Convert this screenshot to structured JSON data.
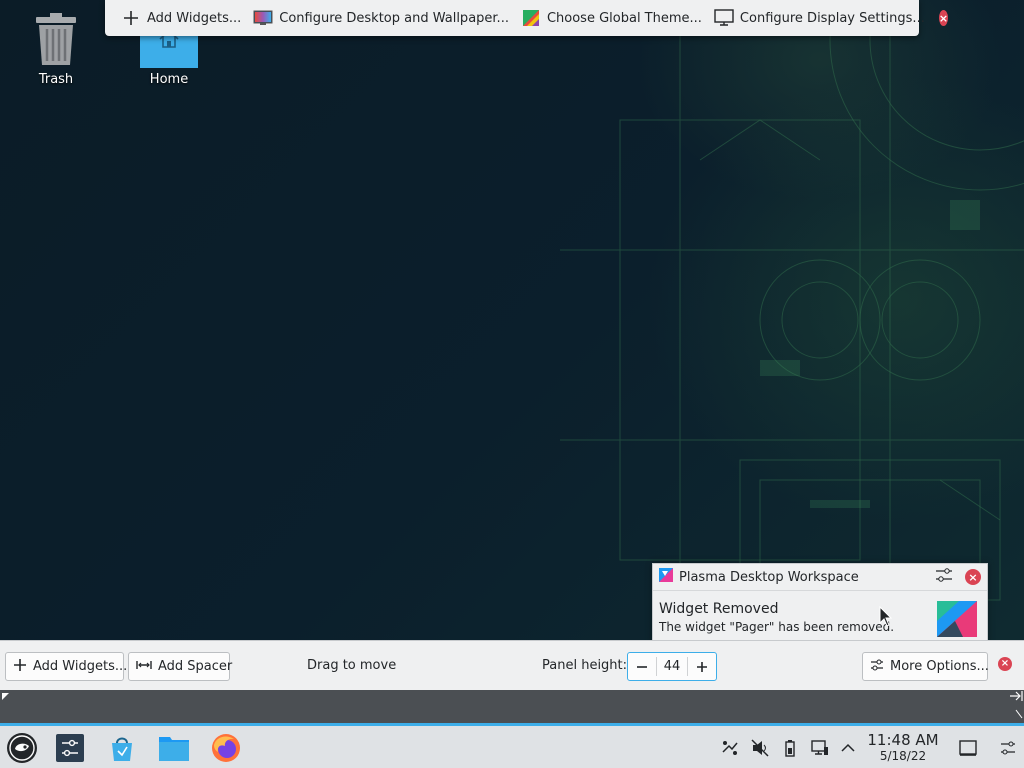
{
  "desktop": {
    "icons": [
      {
        "label": "Trash"
      },
      {
        "label": "Home"
      }
    ]
  },
  "toolbox": {
    "add_widgets": "Add Widgets...",
    "configure_desktop": "Configure Desktop and Wallpaper...",
    "global_theme": "Choose Global Theme...",
    "display_settings": "Configure Display Settings..."
  },
  "notification": {
    "app_name": "Plasma Desktop Workspace",
    "title": "Widget Removed",
    "text": "The widget \"Pager\" has been removed."
  },
  "panel_config": {
    "add_widgets": "Add Widgets...",
    "add_spacer": "Add Spacer",
    "drag_label": "Drag to move",
    "height_label": "Panel height:",
    "height_value": "44",
    "more_options": "More Options..."
  },
  "taskbar": {
    "launchers": [
      "application-launcher",
      "system-settings",
      "discover",
      "dolphin-file-manager",
      "firefox"
    ],
    "tray_icons": [
      "kde-connect-icon",
      "volume-muted-icon",
      "battery-icon",
      "network-icon",
      "expand-tray-icon"
    ],
    "clock_time": "11:48 AM",
    "clock_date": "5/18/22"
  },
  "colors": {
    "accent": "#3daee9",
    "close": "#da4453",
    "panel_bg": "#eff0f1",
    "taskbar_bg": "#dfe2e5"
  }
}
